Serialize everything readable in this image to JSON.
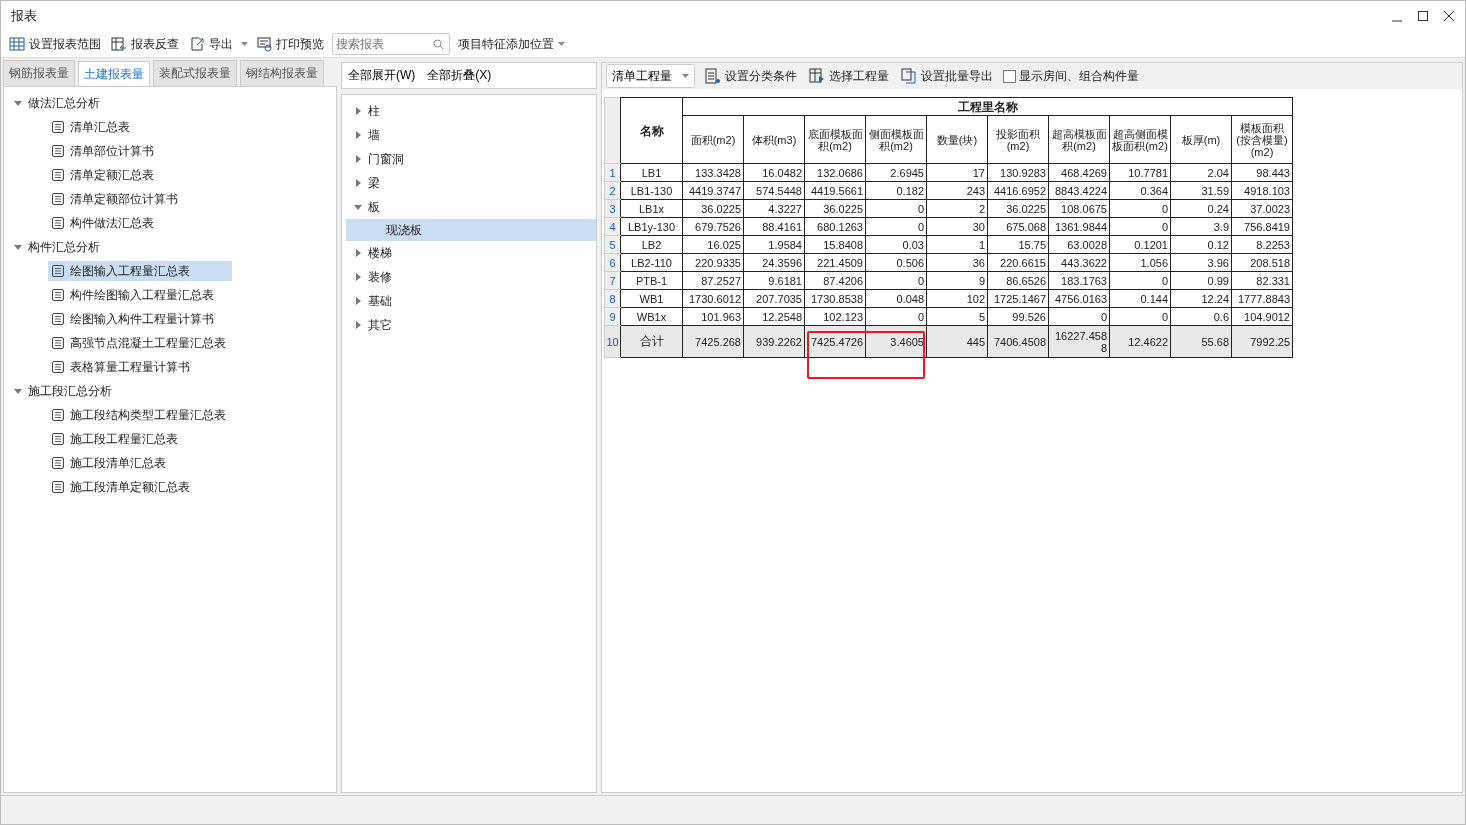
{
  "window": {
    "title": "报表"
  },
  "toolbar": {
    "buttons": [
      {
        "label": "设置报表范围",
        "kind": "grid"
      },
      {
        "label": "报表反查",
        "kind": "lookup"
      },
      {
        "label": "导出",
        "kind": "export",
        "dropdown": true
      },
      {
        "label": "打印预览",
        "kind": "print"
      }
    ],
    "search": {
      "placeholder": "搜索报表"
    },
    "position": {
      "label": "项目特征添加位置"
    }
  },
  "left_tabs": [
    {
      "label": "钢筋报表量",
      "selected": false
    },
    {
      "label": "土建报表量",
      "selected": true
    },
    {
      "label": "装配式报表量",
      "selected": false
    },
    {
      "label": "钢结构报表量",
      "selected": false
    }
  ],
  "report_tree": [
    {
      "label": "做法汇总分析",
      "expanded": true,
      "children": [
        {
          "label": "清单汇总表",
          "selected": false
        },
        {
          "label": "清单部位计算书",
          "selected": false
        },
        {
          "label": "清单定额汇总表",
          "selected": false
        },
        {
          "label": "清单定额部位计算书",
          "selected": false
        },
        {
          "label": "构件做法汇总表",
          "selected": false
        }
      ]
    },
    {
      "label": "构件汇总分析",
      "expanded": true,
      "children": [
        {
          "label": "绘图输入工程量汇总表",
          "selected": true
        },
        {
          "label": "构件绘图输入工程量汇总表",
          "selected": false
        },
        {
          "label": "绘图输入构件工程量计算书",
          "selected": false
        },
        {
          "label": "高强节点混凝土工程量汇总表",
          "selected": false
        },
        {
          "label": "表格算量工程量计算书",
          "selected": false
        }
      ]
    },
    {
      "label": "施工段汇总分析",
      "expanded": true,
      "children": [
        {
          "label": "施工段结构类型工程量汇总表",
          "selected": false
        },
        {
          "label": "施工段工程量汇总表",
          "selected": false
        },
        {
          "label": "施工段清单汇总表",
          "selected": false
        },
        {
          "label": "施工段清单定额汇总表",
          "selected": false
        }
      ]
    }
  ],
  "middle": {
    "buttons": [
      "全部展开(W)",
      "全部折叠(X)"
    ],
    "tree": [
      {
        "label": "柱",
        "expanded": false
      },
      {
        "label": "墙",
        "expanded": false
      },
      {
        "label": "门窗洞",
        "expanded": false
      },
      {
        "label": "梁",
        "expanded": false
      },
      {
        "label": "板",
        "expanded": true,
        "children": [
          {
            "label": "现浇板",
            "selected": true
          }
        ]
      },
      {
        "label": "楼梯",
        "expanded": false
      },
      {
        "label": "装修",
        "expanded": false
      },
      {
        "label": "基础",
        "expanded": false
      },
      {
        "label": "其它",
        "expanded": false
      }
    ]
  },
  "right_toolbar": {
    "dropdown": "清单工程量",
    "buttons": [
      {
        "label": "设置分类条件",
        "kind": "classify"
      },
      {
        "label": "选择工程量",
        "kind": "select"
      },
      {
        "label": "设置批量导出",
        "kind": "batch"
      }
    ],
    "checkbox": {
      "label": "显示房间、组合构件量",
      "checked": false
    }
  },
  "table": {
    "name_header": "名称",
    "group_header": "工程里名称",
    "columns": [
      "面积(m2)",
      "体积(m3)",
      "底面模板面积(m2)",
      "侧面模板面积(m2)",
      "数量(块)",
      "投影面积(m2)",
      "超高模板面积(m2)",
      "超高侧面模板面积(m2)",
      "板厚(m)",
      "模板面积(按含模量)(m2)"
    ],
    "rows": [
      {
        "index": "1",
        "name": "LB1",
        "values": [
          "133.3428",
          "16.0482",
          "132.0686",
          "2.6945",
          "17",
          "130.9283",
          "468.4269",
          "10.7781",
          "2.04",
          "98.443"
        ],
        "total": false
      },
      {
        "index": "2",
        "name": "LB1-130",
        "values": [
          "4419.3747",
          "574.5448",
          "4419.5661",
          "0.182",
          "243",
          "4416.6952",
          "8843.4224",
          "0.364",
          "31.59",
          "4918.103"
        ],
        "total": false
      },
      {
        "index": "3",
        "name": "LB1x",
        "values": [
          "36.0225",
          "4.3227",
          "36.0225",
          "0",
          "2",
          "36.0225",
          "108.0675",
          "0",
          "0.24",
          "37.0023"
        ],
        "total": false
      },
      {
        "index": "4",
        "name": "LB1y-130",
        "values": [
          "679.7526",
          "88.4161",
          "680.1263",
          "0",
          "30",
          "675.068",
          "1361.9844",
          "0",
          "3.9",
          "756.8419"
        ],
        "total": false
      },
      {
        "index": "5",
        "name": "LB2",
        "values": [
          "16.025",
          "1.9584",
          "15.8408",
          "0.03",
          "1",
          "15.75",
          "63.0028",
          "0.1201",
          "0.12",
          "8.2253"
        ],
        "total": false
      },
      {
        "index": "6",
        "name": "LB2-110",
        "values": [
          "220.9335",
          "24.3596",
          "221.4509",
          "0.506",
          "36",
          "220.6615",
          "443.3622",
          "1.056",
          "3.96",
          "208.518"
        ],
        "total": false
      },
      {
        "index": "7",
        "name": "PTB-1",
        "values": [
          "87.2527",
          "9.6181",
          "87.4206",
          "0",
          "9",
          "86.6526",
          "183.1763",
          "0",
          "0.99",
          "82.331"
        ],
        "total": false
      },
      {
        "index": "8",
        "name": "WB1",
        "values": [
          "1730.6012",
          "207.7035",
          "1730.8538",
          "0.048",
          "102",
          "1725.1467",
          "4756.0163",
          "0.144",
          "12.24",
          "1777.8843"
        ],
        "total": false
      },
      {
        "index": "9",
        "name": "WB1x",
        "values": [
          "101.963",
          "12.2548",
          "102.123",
          "0",
          "5",
          "99.526",
          "0",
          "0",
          "0.6",
          "104.9012"
        ],
        "total": false
      },
      {
        "index": "10",
        "name": "合计",
        "values": [
          "7425.268",
          "939.2262",
          "7425.4726",
          "3.4605",
          "445",
          "7406.4508",
          "16227.4588",
          "12.4622",
          "55.68",
          "7992.25"
        ],
        "total": true
      }
    ]
  }
}
